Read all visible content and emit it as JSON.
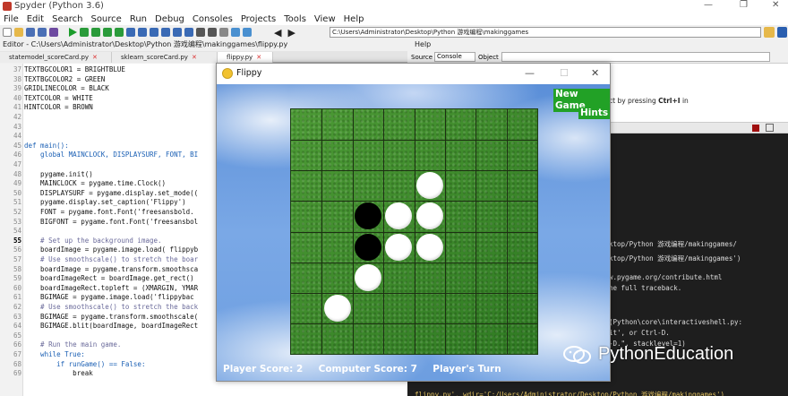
{
  "titlebar": {
    "title": "Spyder (Python 3.6)"
  },
  "menu": [
    "File",
    "Edit",
    "Search",
    "Source",
    "Run",
    "Debug",
    "Consoles",
    "Projects",
    "Tools",
    "View",
    "Help"
  ],
  "path": "C:\\Users\\Administrator\\Desktop\\Python 游戏编程\\makinggames",
  "editor": {
    "header": "Editor - C:\\Users\\Administrator\\Desktop\\Python 游戏编程\\makinggames\\flippy.py",
    "tabs": [
      "statemodel_scoreCard.py",
      "sklearn_scoreCard.py",
      "flippy.py"
    ],
    "lines": [
      {
        "n": "37",
        "t": "TEXTBGCOLOR1 = BRIGHTBLUE"
      },
      {
        "n": "38",
        "t": "TEXTBGCOLOR2 = GREEN"
      },
      {
        "n": "39",
        "t": "GRIDLINECOLOR = BLACK"
      },
      {
        "n": "40",
        "t": "TEXTCOLOR = WHITE"
      },
      {
        "n": "41",
        "t": "HINTCOLOR = BROWN"
      },
      {
        "n": "42",
        "t": ""
      },
      {
        "n": "43",
        "t": ""
      },
      {
        "n": "44",
        "t": ""
      },
      {
        "n": "45",
        "t": "def main():"
      },
      {
        "n": "46",
        "t": "    global MAINCLOCK, DISPLAYSURF, FONT, BI"
      },
      {
        "n": "47",
        "t": ""
      },
      {
        "n": "48",
        "t": "    pygame.init()"
      },
      {
        "n": "49",
        "t": "    MAINCLOCK = pygame.time.Clock()"
      },
      {
        "n": "50",
        "t": "    DISPLAYSURF = pygame.display.set_mode(("
      },
      {
        "n": "51",
        "t": "    pygame.display.set_caption('Flippy')"
      },
      {
        "n": "52",
        "t": "    FONT = pygame.font.Font('freesansbold."
      },
      {
        "n": "53",
        "t": "    BIGFONT = pygame.font.Font('freesansbol"
      },
      {
        "n": "54",
        "t": ""
      },
      {
        "n": "55",
        "t": "    # Set up the background image."
      },
      {
        "n": "56",
        "t": "    boardImage = pygame.image.load( flippyb"
      },
      {
        "n": "57",
        "t": "    # Use smoothscale() to stretch the boar"
      },
      {
        "n": "58",
        "t": "    boardImage = pygame.transform.smoothsca"
      },
      {
        "n": "59",
        "t": "    boardImageRect = boardImage.get_rect()"
      },
      {
        "n": "60",
        "t": "    boardImageRect.topleft = (XMARGIN, YMAR"
      },
      {
        "n": "61",
        "t": "    BGIMAGE = pygame.image.load('flippybac"
      },
      {
        "n": "62",
        "t": "    # Use smoothscale() to stretch the back"
      },
      {
        "n": "63",
        "t": "    BGIMAGE = pygame.transform.smoothscale("
      },
      {
        "n": "64",
        "t": "    BGIMAGE.blit(boardImage, boardImageRect"
      },
      {
        "n": "65",
        "t": ""
      },
      {
        "n": "66",
        "t": "    # Run the main game."
      },
      {
        "n": "67",
        "t": "    while True:"
      },
      {
        "n": "68",
        "t": "        if runGame() == False:"
      },
      {
        "n": "69",
        "t": "            break"
      }
    ]
  },
  "help": {
    "header": "Help",
    "source_label": "Source",
    "source_value": "Console",
    "object_label": "Object",
    "text": "ct by pressing ",
    "shortcut": "Ctrl+I",
    "text_after": " in"
  },
  "console": {
    "lines": [
      "ktop/Python 游戏编程/makinggames/",
      "ktop/Python 游戏编程/makinggames')",
      "",
      "w.pygame.org/contribute.html",
      "he full traceback.",
      "",
      "",
      "(Python\\core\\interactiveshell.py:",
      "it', or Ctrl-D.",
      "-D.\", stacklevel=1)",
      "",
      "",
      "flippy.py', wdir='C:/Users/Administrator/Desktop/Python 游戏编程/makinggames')"
    ]
  },
  "game": {
    "title": "Flippy",
    "new_game": "New Game",
    "hints": "Hints",
    "player_score_label": "Player Score:",
    "player_score": "2",
    "computer_score_label": "Computer Score:",
    "computer_score": "7",
    "turn": "Player's Turn",
    "board_size": 8,
    "pieces": [
      {
        "row": 2,
        "col": 4,
        "color": "white"
      },
      {
        "row": 3,
        "col": 2,
        "color": "black"
      },
      {
        "row": 3,
        "col": 3,
        "color": "white"
      },
      {
        "row": 3,
        "col": 4,
        "color": "white"
      },
      {
        "row": 4,
        "col": 2,
        "color": "black"
      },
      {
        "row": 4,
        "col": 3,
        "color": "white"
      },
      {
        "row": 4,
        "col": 4,
        "color": "white"
      },
      {
        "row": 5,
        "col": 2,
        "color": "white"
      },
      {
        "row": 6,
        "col": 1,
        "color": "white"
      }
    ]
  },
  "watermark": "PythonEducation"
}
